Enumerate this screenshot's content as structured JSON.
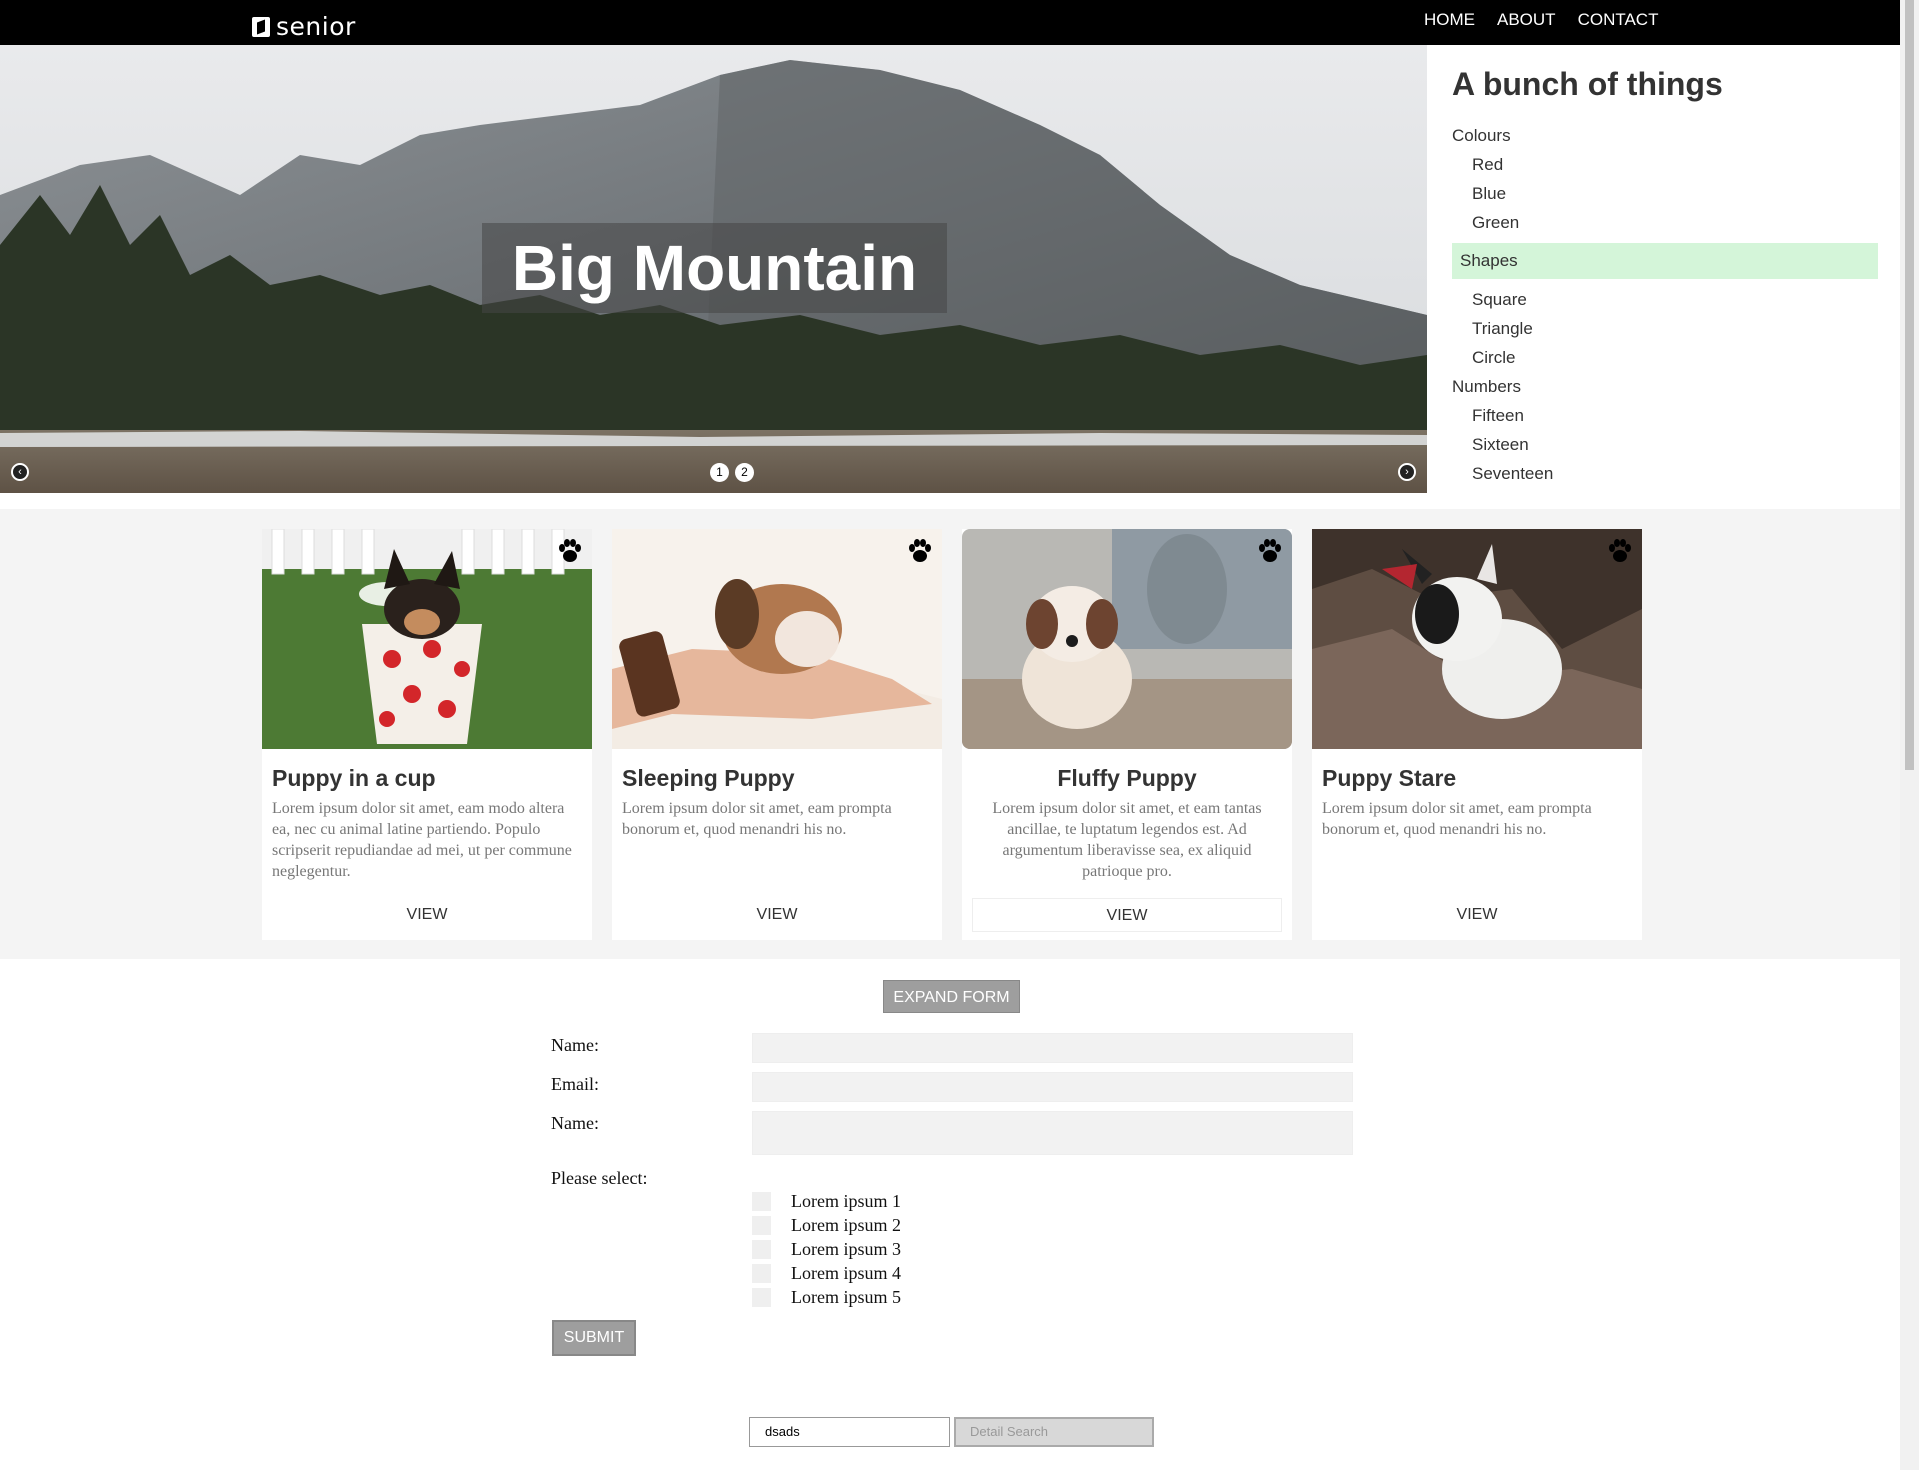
{
  "header": {
    "logo_text": "senior",
    "nav": [
      "HOME",
      "ABOUT",
      "CONTACT"
    ]
  },
  "hero": {
    "caption": "Big Mountain",
    "prev_label": "‹",
    "next_label": "›",
    "dots": [
      "1",
      "2"
    ]
  },
  "tree": {
    "title": "A bunch of things",
    "groups": [
      {
        "label": "Colours",
        "items": [
          "Red",
          "Blue",
          "Green"
        ]
      },
      {
        "label": "Shapes",
        "items": [
          "Square",
          "Triangle",
          "Circle"
        ]
      },
      {
        "label": "Numbers",
        "items": [
          "Fifteen",
          "Sixteen",
          "Seventeen"
        ]
      }
    ]
  },
  "cards": [
    {
      "title": "Puppy in a cup",
      "text": "Lorem ipsum dolor sit amet, eam modo altera ea, nec cu animal latine partiendo. Populo scripserit repudiandae ad mei, ut per commune neglegentur.",
      "view": "VIEW",
      "icon": "paw-icon"
    },
    {
      "title": "Sleeping Puppy",
      "text": "Lorem ipsum dolor sit amet, eam prompta bonorum et, quod menandri his no.",
      "view": "VIEW",
      "icon": "paw-icon"
    },
    {
      "title": "Fluffy Puppy",
      "text": "Lorem ipsum dolor sit amet, et eam tantas ancillae, te luptatum legendos est. Ad argumentum liberavisse sea, ex aliquid patrioque pro.",
      "view": "VIEW",
      "icon": "paw-icon"
    },
    {
      "title": "Puppy Stare",
      "text": "Lorem ipsum dolor sit amet, eam prompta bonorum et, quod menandri his no.",
      "view": "VIEW",
      "icon": "paw-icon"
    }
  ],
  "form": {
    "expand_label": "EXPAND FORM",
    "name_label": "Name:",
    "email_label": "Email:",
    "name2_label": "Name:",
    "select_label": "Please select:",
    "options": [
      "Lorem ipsum 1",
      "Lorem ipsum 2",
      "Lorem ipsum 3",
      "Lorem ipsum 4",
      "Lorem ipsum 5"
    ],
    "submit_label": "SUBMIT"
  },
  "search": {
    "value": "dsads",
    "button_label": "Detail Search"
  },
  "colors": {
    "active_tree_bg": "#d4f5d9",
    "topbar": "#000000",
    "band": "#f4f4f4"
  }
}
